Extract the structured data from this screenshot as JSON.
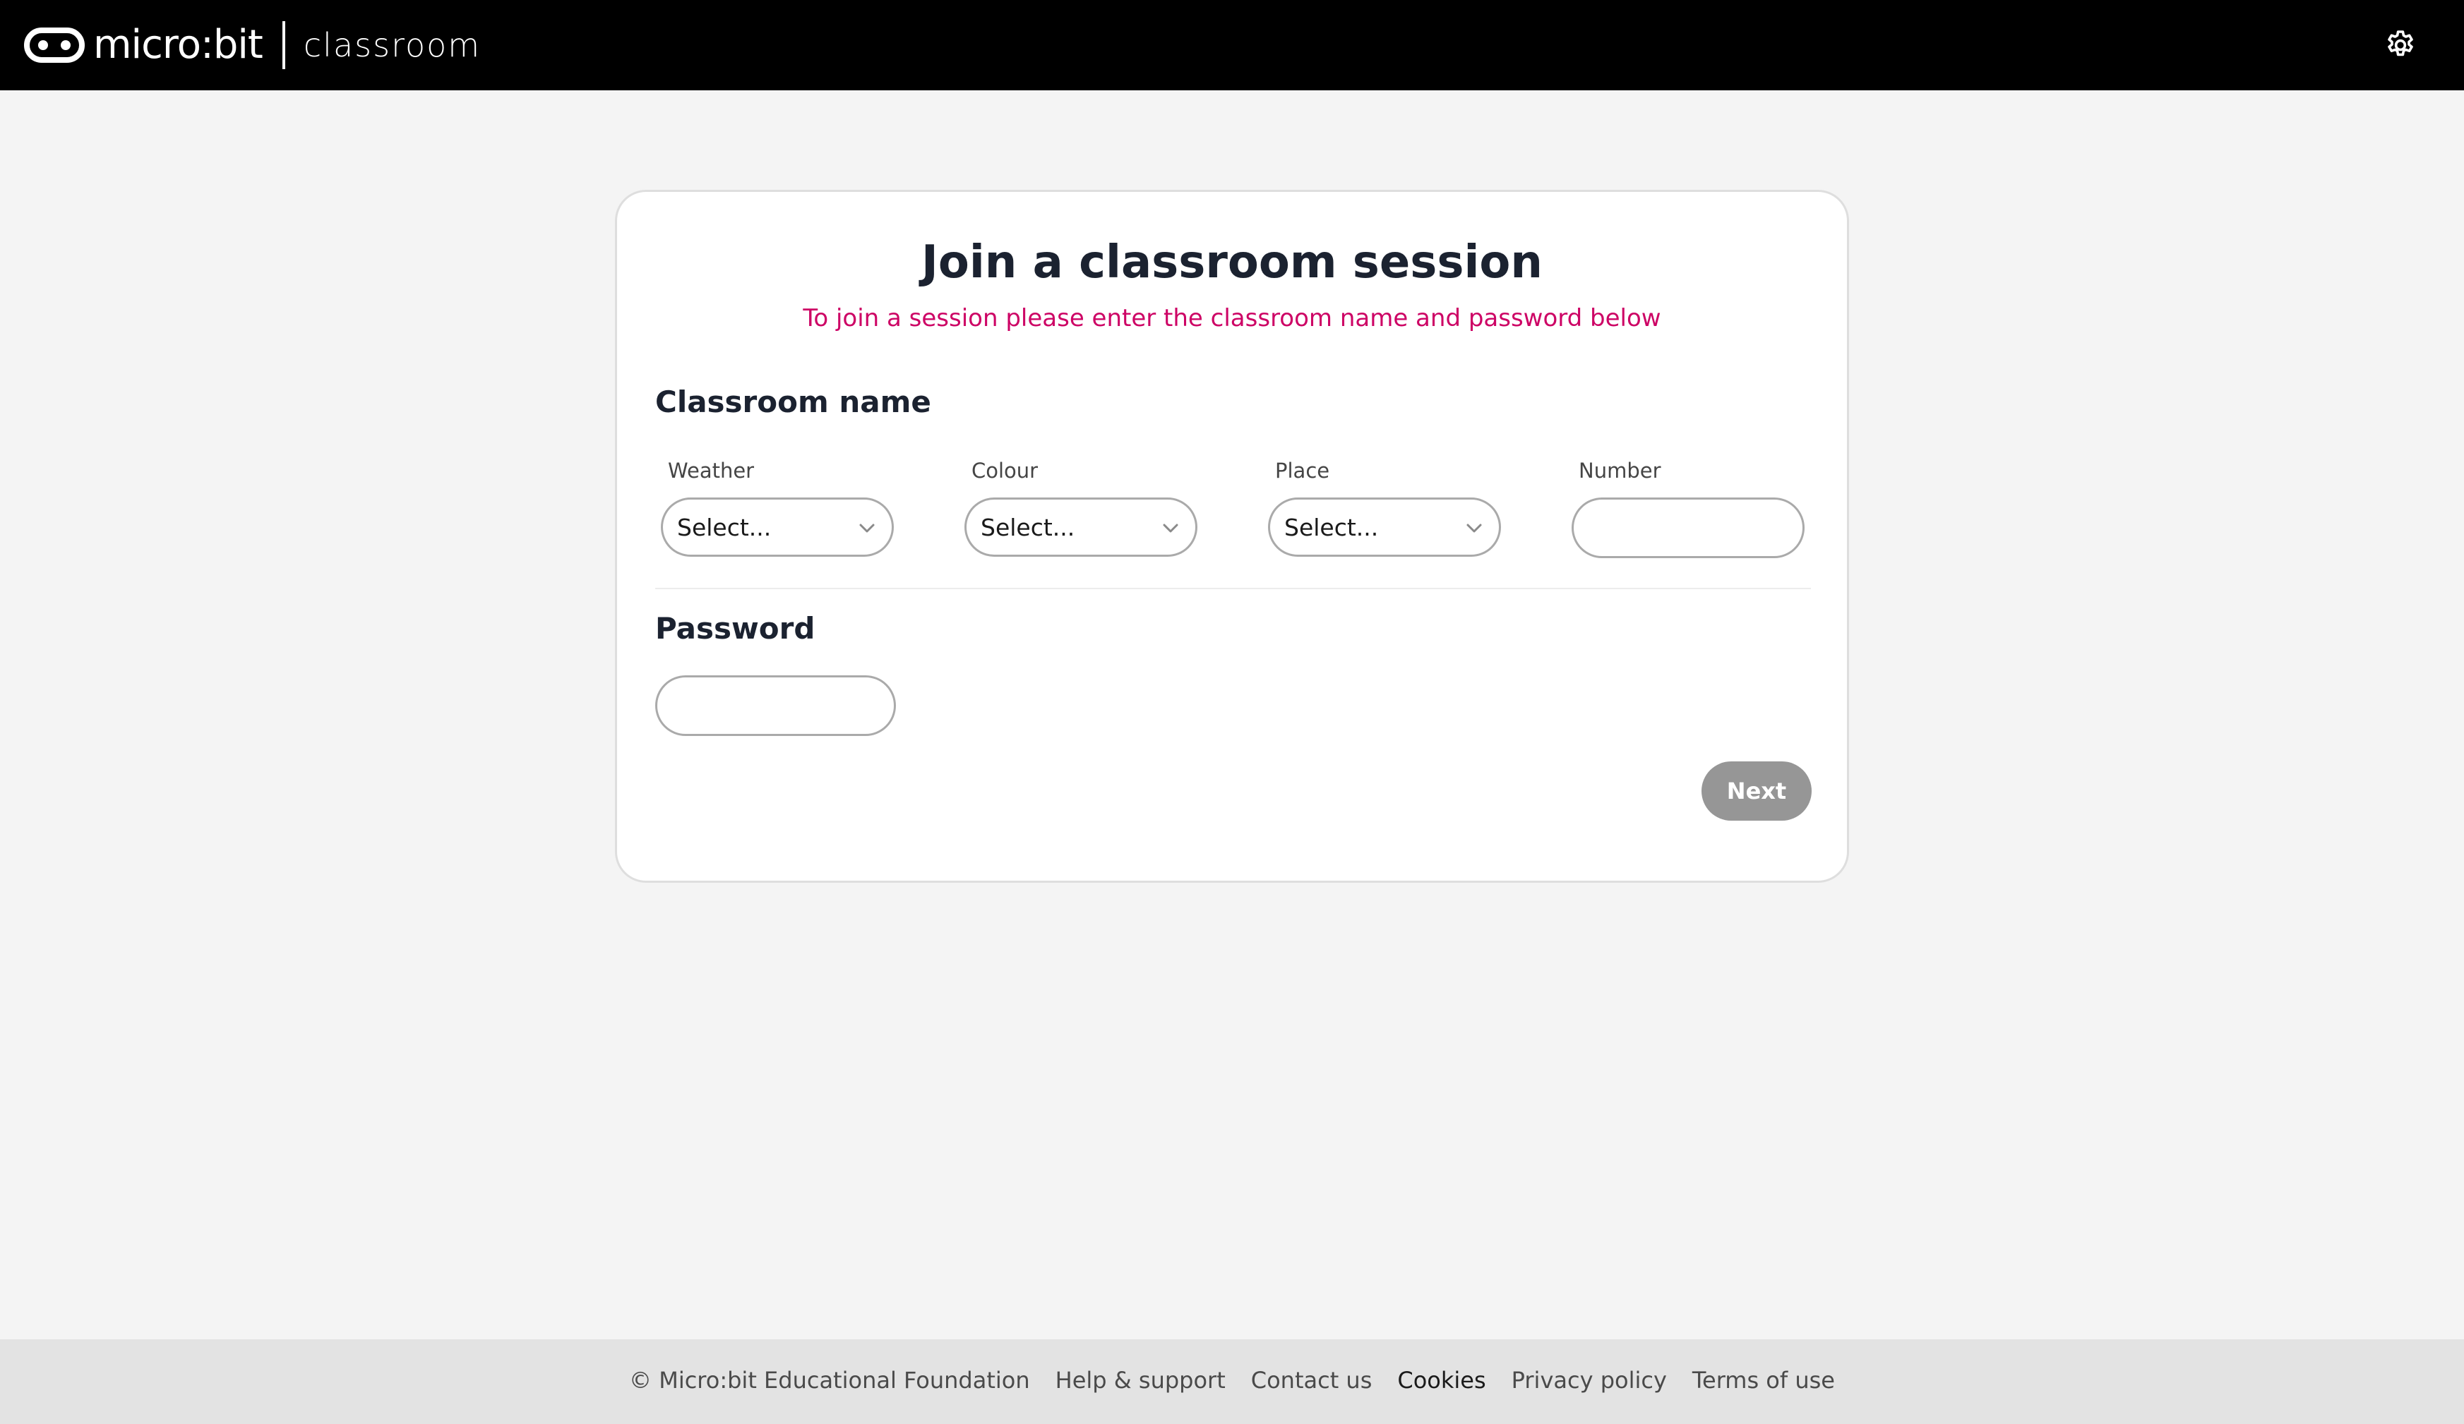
{
  "header": {
    "brand_name": "micro:bit",
    "product_name": "classroom",
    "settings_icon": "gear-icon",
    "colors": {
      "background": "#000000",
      "text": "#ffffff"
    }
  },
  "card": {
    "title": "Join a classroom session",
    "subtitle": "To join a session please enter the classroom name and password below",
    "classroom_name_heading": "Classroom name",
    "fields": {
      "weather": {
        "label": "Weather",
        "value": "Select..."
      },
      "colour": {
        "label": "Colour",
        "value": "Select..."
      },
      "place": {
        "label": "Place",
        "value": "Select..."
      },
      "number": {
        "label": "Number",
        "value": ""
      }
    },
    "password_heading": "Password",
    "password_value": "",
    "next_label": "Next",
    "colors": {
      "subtitle": "#cd0365",
      "next_disabled": "#969696"
    }
  },
  "footer": {
    "copyright": "© Micro:bit Educational Foundation",
    "links": [
      "Help & support",
      "Contact us",
      "Cookies",
      "Privacy policy",
      "Terms of use"
    ]
  }
}
